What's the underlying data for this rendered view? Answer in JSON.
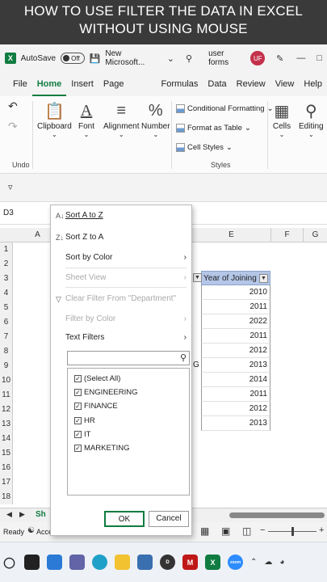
{
  "caption": {
    "line1": "HOW TO USE FILTER THE DATA IN EXCEL",
    "line2": "WITHOUT USING MOUSE"
  },
  "titlebar": {
    "autosave_label": "AutoSave",
    "autosave_state": "Off",
    "filename": "New Microsoft...",
    "search_text": "user forms",
    "avatar_initials": "UF"
  },
  "tabs": [
    "File",
    "Home",
    "Insert",
    "Page Layout",
    "Formulas",
    "Data",
    "Review",
    "View",
    "Help"
  ],
  "ribbon": {
    "clipboard": "Clipboard",
    "font": "Font",
    "alignment": "Alignment",
    "number": "Number",
    "undo_group": "Undo",
    "conditional_formatting": "Conditional Formatting",
    "format_as_table": "Format as Table",
    "cell_styles": "Cell Styles",
    "styles_group": "Styles",
    "cells": "Cells",
    "editing": "Editing"
  },
  "formula_bar": {
    "name_box": "D3"
  },
  "columns": [
    "A",
    "E",
    "F",
    "G"
  ],
  "rows": [
    "1",
    "2",
    "3",
    "4",
    "5",
    "6",
    "7",
    "8",
    "9",
    "10",
    "11",
    "12",
    "13",
    "14",
    "15",
    "16",
    "17",
    "18"
  ],
  "table": {
    "header": "Year of Joining",
    "values": [
      "2010",
      "2011",
      "2022",
      "2011",
      "2012",
      "2013",
      "2014",
      "2011",
      "2012",
      "2013"
    ],
    "partial_g": "G"
  },
  "filter_menu": {
    "sort_a_z": "Sort A to Z",
    "sort_z_a": "Sort Z to A",
    "sort_by_color": "Sort by Color",
    "sheet_view": "Sheet View",
    "clear_filter": "Clear Filter From \"Department\"",
    "filter_by_color": "Filter by Color",
    "text_filters": "Text Filters",
    "items": [
      "(Select All)",
      "ENGINEERING",
      "FINANCE",
      "HR",
      "IT",
      "MARKETING"
    ],
    "ok": "OK",
    "cancel": "Cancel"
  },
  "status": {
    "ready": "Ready",
    "accessibility": "Acces",
    "sheet_tab": "Sh"
  }
}
